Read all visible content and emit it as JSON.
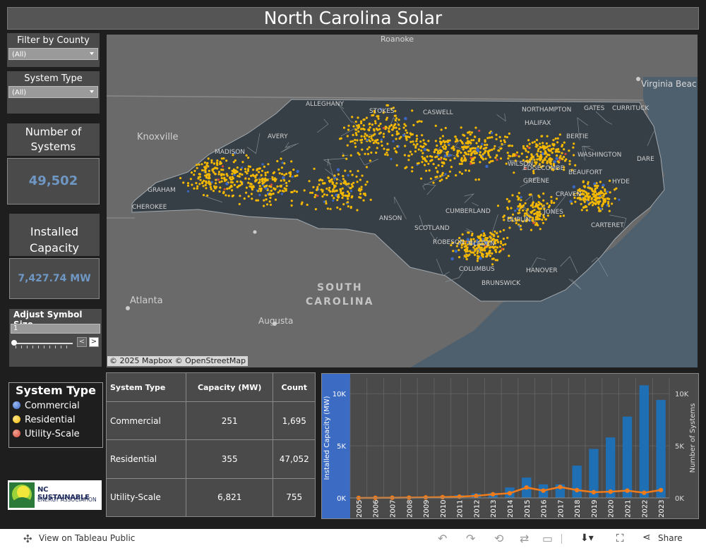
{
  "title": "North Carolina Solar",
  "filters": {
    "county": {
      "label": "Filter by County",
      "value": "(All)"
    },
    "system_type": {
      "label": "System Type",
      "value": "(All)"
    }
  },
  "kpis": {
    "systems": {
      "label_line1": "Number of",
      "label_line2": "Systems",
      "value": "49,502"
    },
    "capacity": {
      "label_line1": "Installed",
      "label_line2": "Capacity",
      "value": "7,427.74 MW"
    }
  },
  "symbol_size": {
    "label": "Adjust Symbol Size",
    "value": "1",
    "fraction": 0.0
  },
  "legend": {
    "title": "System Type",
    "items": [
      {
        "label": "Commercial",
        "color": "#3a68c4"
      },
      {
        "label": "Residential",
        "color": "#f5b800"
      },
      {
        "label": "Utility-Scale",
        "color": "#d64a3a"
      }
    ]
  },
  "logo": {
    "line1": "NC SUSTAINABLE",
    "line2": "ENERGY ASSOCIATION"
  },
  "map": {
    "attribution": "© 2025 Mapbox  © OpenStreetMap",
    "labels": {
      "roanoke": "Roanoke",
      "virginia_beach": "Virginia Beac",
      "knoxville": "Knoxville",
      "atlanta": "Atlanta",
      "augusta": "Augusta",
      "south": "SOUTH",
      "carolina": "CAROLINA",
      "alleghany": "ALLEGHANY",
      "stokes": "STOKES",
      "caswell": "CASWELL",
      "northampton": "NORTHAMPTON",
      "gates": "GATES",
      "currituck": "CURRITUCK",
      "halifax": "HALIFAX",
      "bertie": "BERTIE",
      "edgecombe": "EDGECOMBE",
      "washington": "WASHINGTON",
      "dare": "DARE",
      "wilson": "WILSON",
      "beaufort": "BEAUFORT",
      "hyde": "HYDE",
      "greene": "GREENE",
      "craven": "CRAVEN",
      "jones": "JONES",
      "madison": "MADISON",
      "graham": "GRAHAM",
      "cherokee": "CHEROKEE",
      "avery": "AVERY",
      "anson": "ANSON",
      "scotland": "SCOTLAND",
      "robeson": "ROBESON",
      "bladen": "BLADEN",
      "columbus": "COLUMBUS",
      "brunswick": "BRUNSWICK",
      "hanover": "HANOVER",
      "duplin": "DUPLIN",
      "cumberland": "CUMBERLAND",
      "carteret": "CARTERET"
    }
  },
  "table": {
    "headers": [
      "System Type",
      "Capacity (MW)",
      "Count"
    ],
    "rows": [
      [
        "Commercial",
        "251",
        "1,695"
      ],
      [
        "Residential",
        "355",
        "47,052"
      ],
      [
        "Utility-Scale",
        "6,821",
        "755"
      ]
    ]
  },
  "chart_data": {
    "type": "bar",
    "categories": [
      "2005",
      "2006",
      "2007",
      "2008",
      "2009",
      "2010",
      "2011",
      "2012",
      "2013",
      "2014",
      "2015",
      "2016",
      "2017",
      "2018",
      "2019",
      "2020",
      "2021",
      "2022",
      "2023"
    ],
    "series": [
      {
        "name": "Installed Capacity (MW)",
        "type": "bar",
        "axis": "left",
        "color": "#1f6fb5",
        "values": [
          0,
          0,
          5,
          10,
          20,
          60,
          280,
          430,
          490,
          1000,
          1950,
          1300,
          1300,
          3100,
          4700,
          5800,
          7800,
          10800,
          9400
        ]
      },
      {
        "name": "Number of Systems",
        "type": "line",
        "axis": "right",
        "color": "#f07b1a",
        "values": [
          0,
          10,
          20,
          30,
          50,
          80,
          120,
          200,
          350,
          450,
          1000,
          700,
          1050,
          750,
          550,
          600,
          700,
          500,
          750
        ]
      }
    ],
    "ylabel_left": "Installed Capacity (MW)",
    "ylabel_right": "Number of Systems",
    "left_ticks": [
      "0K",
      "5K",
      "10K"
    ],
    "right_ticks": [
      "0K",
      "5K",
      "10K"
    ],
    "ylim_left": [
      0,
      11500
    ],
    "ylim_right": [
      0,
      11500
    ]
  },
  "footer": {
    "view_label": "View on Tableau Public",
    "share_label": "Share"
  }
}
